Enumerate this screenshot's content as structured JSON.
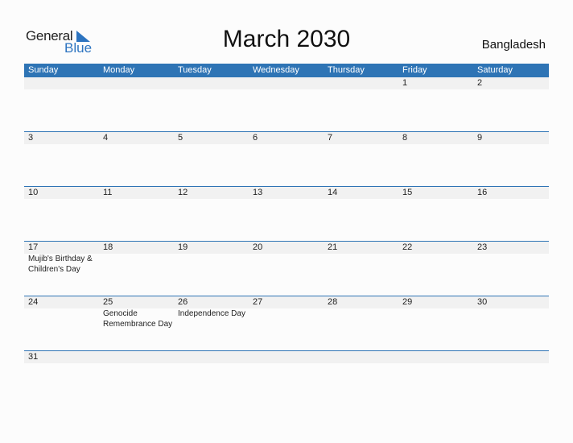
{
  "logo": {
    "general": "General",
    "blue": "Blue"
  },
  "title": "March 2030",
  "country": "Bangladesh",
  "weekdays": [
    "Sunday",
    "Monday",
    "Tuesday",
    "Wednesday",
    "Thursday",
    "Friday",
    "Saturday"
  ],
  "colors": {
    "accent": "#2e74b5",
    "band": "#f1f1f1"
  },
  "weeks": [
    [
      {
        "d": ""
      },
      {
        "d": ""
      },
      {
        "d": ""
      },
      {
        "d": ""
      },
      {
        "d": ""
      },
      {
        "d": "1"
      },
      {
        "d": "2"
      }
    ],
    [
      {
        "d": "3"
      },
      {
        "d": "4"
      },
      {
        "d": "5"
      },
      {
        "d": "6"
      },
      {
        "d": "7"
      },
      {
        "d": "8"
      },
      {
        "d": "9"
      }
    ],
    [
      {
        "d": "10"
      },
      {
        "d": "11"
      },
      {
        "d": "12"
      },
      {
        "d": "13"
      },
      {
        "d": "14"
      },
      {
        "d": "15"
      },
      {
        "d": "16"
      }
    ],
    [
      {
        "d": "17",
        "e": "Mujib's Birthday & Children's Day"
      },
      {
        "d": "18"
      },
      {
        "d": "19"
      },
      {
        "d": "20"
      },
      {
        "d": "21"
      },
      {
        "d": "22"
      },
      {
        "d": "23"
      }
    ],
    [
      {
        "d": "24"
      },
      {
        "d": "25",
        "e": "Genocide Remembrance Day"
      },
      {
        "d": "26",
        "e": "Independence Day"
      },
      {
        "d": "27"
      },
      {
        "d": "28"
      },
      {
        "d": "29"
      },
      {
        "d": "30"
      }
    ],
    [
      {
        "d": "31"
      },
      {
        "d": ""
      },
      {
        "d": ""
      },
      {
        "d": ""
      },
      {
        "d": ""
      },
      {
        "d": ""
      },
      {
        "d": ""
      }
    ]
  ]
}
